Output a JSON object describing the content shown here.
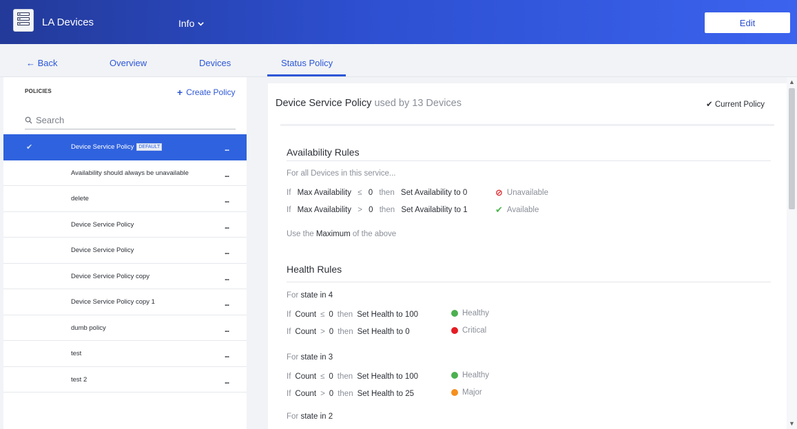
{
  "header": {
    "app_title": "LA Devices",
    "info_label": "Info",
    "edit_label": "Edit"
  },
  "tabs": {
    "back": "← Back",
    "overview": "Overview",
    "devices": "Devices",
    "status_policy": "Status Policy"
  },
  "sidebar": {
    "heading": "POLICIES",
    "create_label": "Create Policy",
    "search_placeholder": "Search",
    "default_badge": "DEFAULT",
    "items": [
      {
        "name": "Device Service Policy",
        "selected": true,
        "default": true
      },
      {
        "name": "Availability should always be unavailable"
      },
      {
        "name": "delete"
      },
      {
        "name": "Device Service Policy"
      },
      {
        "name": "Device Service Policy"
      },
      {
        "name": "Device Service Policy copy"
      },
      {
        "name": "Device Service Policy copy 1"
      },
      {
        "name": "dumb policy"
      },
      {
        "name": "test"
      },
      {
        "name": "test 2"
      }
    ],
    "menu_label": "..."
  },
  "panel": {
    "policy_name": "Device Service Policy",
    "used_by": "used by 13 Devices",
    "current_policy": "Current Policy",
    "availability": {
      "title": "Availability Rules",
      "scope": "For all Devices in this service...",
      "rules": [
        {
          "if": "If",
          "metric": "Max Availability",
          "op": "≤",
          "val": "0",
          "then": "then",
          "action": "Set Availability to 0",
          "status": "Unavailable"
        },
        {
          "if": "If",
          "metric": "Max Availability",
          "op": ">",
          "val": "0",
          "then": "then",
          "action": "Set Availability to 1",
          "status": "Available"
        }
      ],
      "use_prefix": "Use the",
      "use_word": "Maximum",
      "use_suffix": "of the above"
    },
    "health": {
      "title": "Health Rules",
      "groups": [
        {
          "for": "For",
          "state": "state",
          "in": "in",
          "num": "4",
          "rules": [
            {
              "if": "If",
              "metric": "Count",
              "op": "≤",
              "val": "0",
              "then": "then",
              "action": "Set Health to 100",
              "status": "Healthy",
              "color": "#4caf50"
            },
            {
              "if": "If",
              "metric": "Count",
              "op": ">",
              "val": "0",
              "then": "then",
              "action": "Set Health to 0",
              "status": "Critical",
              "color": "#e51c23"
            }
          ]
        },
        {
          "for": "For",
          "state": "state",
          "in": "in",
          "num": "3",
          "rules": [
            {
              "if": "If",
              "metric": "Count",
              "op": "≤",
              "val": "0",
              "then": "then",
              "action": "Set Health to 100",
              "status": "Healthy",
              "color": "#4caf50"
            },
            {
              "if": "If",
              "metric": "Count",
              "op": ">",
              "val": "0",
              "then": "then",
              "action": "Set Health to 25",
              "status": "Major",
              "color": "#f68f1e"
            }
          ]
        },
        {
          "for": "For",
          "state": "state",
          "in": "in",
          "num": "2"
        }
      ]
    }
  },
  "colors": {
    "accent": "#2d56d6",
    "unavailable": "#e0262b",
    "available": "#49b54a"
  }
}
